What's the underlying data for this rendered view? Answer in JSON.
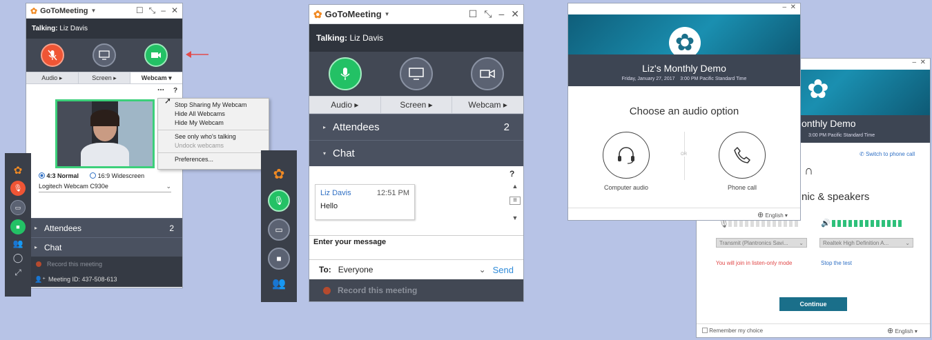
{
  "brand": {
    "name": "GoToMeeting"
  },
  "panel1": {
    "talking_label": "Talking:",
    "talking_name": "Liz Davis",
    "tabs": [
      "Audio",
      "Screen",
      "Webcam"
    ],
    "menu": {
      "items": [
        "Stop Sharing My Webcam",
        "Hide All Webcams",
        "Hide My Webcam"
      ],
      "items2": [
        "See only who's talking"
      ],
      "disabled": [
        "Undock webcams"
      ],
      "items3": [
        "Preferences..."
      ]
    },
    "ratio_normal": "4:3 Normal",
    "ratio_wide": "16:9 Widescreen",
    "webcam_device": "Logitech Webcam C930e",
    "attendees_label": "Attendees",
    "attendees_count": "2",
    "chat_label": "Chat",
    "record_label": "Record this meeting",
    "meeting_id_label": "Meeting ID: 437-508-613",
    "help": "?",
    "more": "..."
  },
  "panel2": {
    "talking_label": "Talking:",
    "talking_name": "Liz Davis",
    "tabs": [
      "Audio",
      "Screen",
      "Webcam"
    ],
    "attendees_label": "Attendees",
    "attendees_count": "2",
    "chat_label": "Chat",
    "help": "?",
    "msg_sender": "Liz Davis",
    "msg_time": "12:51 PM",
    "msg_text": "Hello",
    "input_placeholder": "Enter your message",
    "to_label": "To:",
    "to_value": "Everyone",
    "send_label": "Send",
    "record_label": "Record this meeting"
  },
  "panel3": {
    "meeting_title": "Liz's Monthly Demo",
    "meeting_date": "Friday, January 27, 2017",
    "meeting_time": "3:00 PM Pacific Standard Time",
    "choose_label": "Choose an audio option",
    "computer_audio_label": "Computer audio",
    "phone_call_label": "Phone call",
    "or_label": "OR",
    "language": "English"
  },
  "panel4": {
    "title_partial": "onthly Demo",
    "time": "3:00 PM Pacific Standard Time",
    "switch_label": "Switch to phone call",
    "mic_title_partial": "nic & speakers",
    "transmit_select": "Transmit (Plantronics Savi...",
    "realtek_select": "Realtek High Definition A...",
    "listen_only": "You will join in listen-only mode",
    "stop_test": "Stop the test",
    "continue_label": "Continue",
    "remember_label": "Remember my choice",
    "language": "English"
  },
  "colors": {
    "mic_red": "#ef5535",
    "green": "#23c165",
    "blue_text": "#2e6fc4",
    "accent_teal": "#1a6f8a"
  }
}
